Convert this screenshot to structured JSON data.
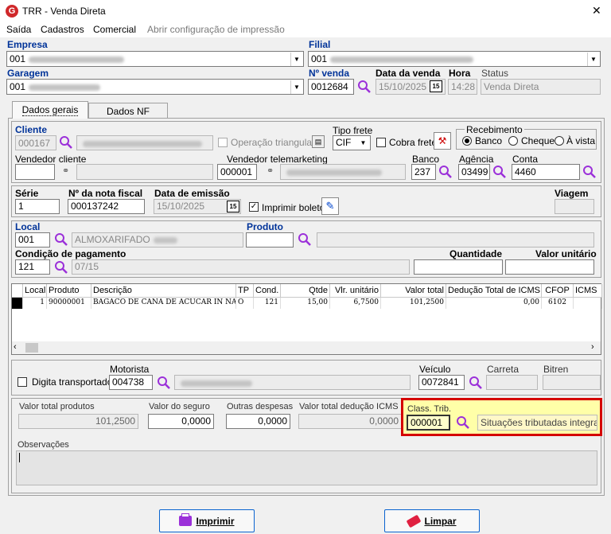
{
  "window": {
    "title": "TRR - Venda Direta",
    "close_glyph": "✕"
  },
  "menu": [
    "Saída",
    "Cadastros",
    "Comercial",
    "Abrir configuração de impressão"
  ],
  "header": {
    "empresa_label": "Empresa",
    "empresa_value": "001",
    "filial_label": "Filial",
    "filial_value": "001",
    "garagem_label": "Garagem",
    "garagem_value": "001",
    "nvenda_label": "Nº venda",
    "nvenda_value": "0012684",
    "data_venda_label": "Data da venda",
    "data_venda_value": "15/10/2025",
    "hora_label": "Hora",
    "hora_value": "14:28",
    "status_label": "Status",
    "status_value": "Venda Direta"
  },
  "tabs": [
    "Dados gerais",
    "Dados NF"
  ],
  "cliente": {
    "label": "Cliente",
    "value": "000167",
    "operacao_triangular": "Operação triangular",
    "tipo_frete_label": "Tipo frete",
    "tipo_frete_value": "CIF",
    "cobra_frete": "Cobra frete",
    "recebimento_label": "Recebimento",
    "recebimento_options": [
      "Banco",
      "Cheque",
      "À vista"
    ],
    "vendedor_cliente_label": "Vendedor cliente",
    "vendedor_tele_label": "Vendedor telemarketing",
    "vendedor_tele_value": "000001",
    "banco_label": "Banco",
    "banco_value": "237",
    "agencia_label": "Agência",
    "agencia_value": "03499",
    "conta_label": "Conta",
    "conta_value": "4460"
  },
  "nota": {
    "serie_label": "Série",
    "serie_value": "1",
    "numero_label": "Nº da nota fiscal",
    "numero_value": "000137242",
    "emissao_label": "Data de emissão",
    "emissao_value": "15/10/2025",
    "imprimir_boleto": "Imprimir boleto",
    "viagem_label": "Viagem"
  },
  "local": {
    "label": "Local",
    "value": "001",
    "desc": "ALMOXARIFADO",
    "produto_label": "Produto",
    "cond_label": "Condição de pagamento",
    "cond_value": "121",
    "cond_desc": "07/15",
    "quantidade_label": "Quantidade",
    "valor_unit_label": "Valor unitário"
  },
  "table": {
    "headers": [
      "Local",
      "Produto",
      "Descrição",
      "TP",
      "Cond.",
      "Qtde",
      "Vlr. unitário",
      "Valor total",
      "Dedução Total de ICMS",
      "CFOP",
      "ICMS"
    ],
    "rows": [
      [
        "1",
        "90000001",
        "BAGACO DE CANA DE ACUCAR IN NA",
        "O",
        "121",
        "15,00",
        "6,7500",
        "101,2500",
        "0,00",
        "6102",
        ""
      ]
    ]
  },
  "transport": {
    "digita_transportador": "Digita transportador",
    "motorista_label": "Motorista",
    "motorista_value": "004738",
    "veiculo_label": "Veículo",
    "veiculo_value": "0072841",
    "carreta_label": "Carreta",
    "bitren_label": "Bitren"
  },
  "totais": {
    "valor_produtos_label": "Valor total produtos",
    "valor_produtos_value": "101,2500",
    "valor_seguro_label": "Valor do seguro",
    "valor_seguro_value": "0,0000",
    "outras_label": "Outras despesas",
    "outras_value": "0,0000",
    "deducao_label": "Valor total dedução ICMS",
    "deducao_value": "0,0000",
    "class_trib_label": "Class. Trib.",
    "class_trib_value": "000001",
    "class_trib_desc": "Situações tributadas integralme"
  },
  "observacoes_label": "Observações",
  "buttons": {
    "imprimir": "Imprimir",
    "limpar": "Limpar"
  },
  "colors": {
    "label_blue": "#003399",
    "highlight_border": "#d40000",
    "highlight_fill": "#ffffa8",
    "search_icon": "#9b30d9"
  }
}
